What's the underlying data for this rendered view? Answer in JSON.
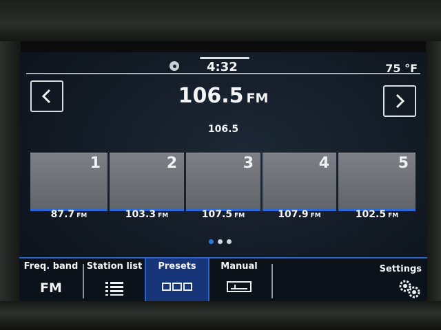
{
  "status": {
    "time": "4:32",
    "temperature": "75 °F"
  },
  "header": {
    "frequency": "106.5",
    "band_unit": "FM",
    "station_text": "106.5",
    "prev_icon": "chevron-left-icon",
    "next_icon": "chevron-right-icon"
  },
  "presets": [
    {
      "number": "1",
      "frequency": "87.7",
      "unit": "FM"
    },
    {
      "number": "2",
      "frequency": "103.3",
      "unit": "FM"
    },
    {
      "number": "3",
      "frequency": "107.5",
      "unit": "FM"
    },
    {
      "number": "4",
      "frequency": "107.9",
      "unit": "FM"
    },
    {
      "number": "5",
      "frequency": "102.5",
      "unit": "FM"
    }
  ],
  "pager": {
    "pages": 3,
    "active": 1
  },
  "bottom_bar": {
    "freq_band_label": "Freq. band",
    "freq_band_value": "FM",
    "station_list_label": "Station list",
    "presets_label": "Presets",
    "manual_label": "Manual",
    "settings_label": "Settings",
    "active_tab": "Presets"
  },
  "colors": {
    "accent": "#2c67d9",
    "active_tab": "#17367a",
    "screen_bg": "#121a24",
    "preset_tile": "#6e7277"
  }
}
